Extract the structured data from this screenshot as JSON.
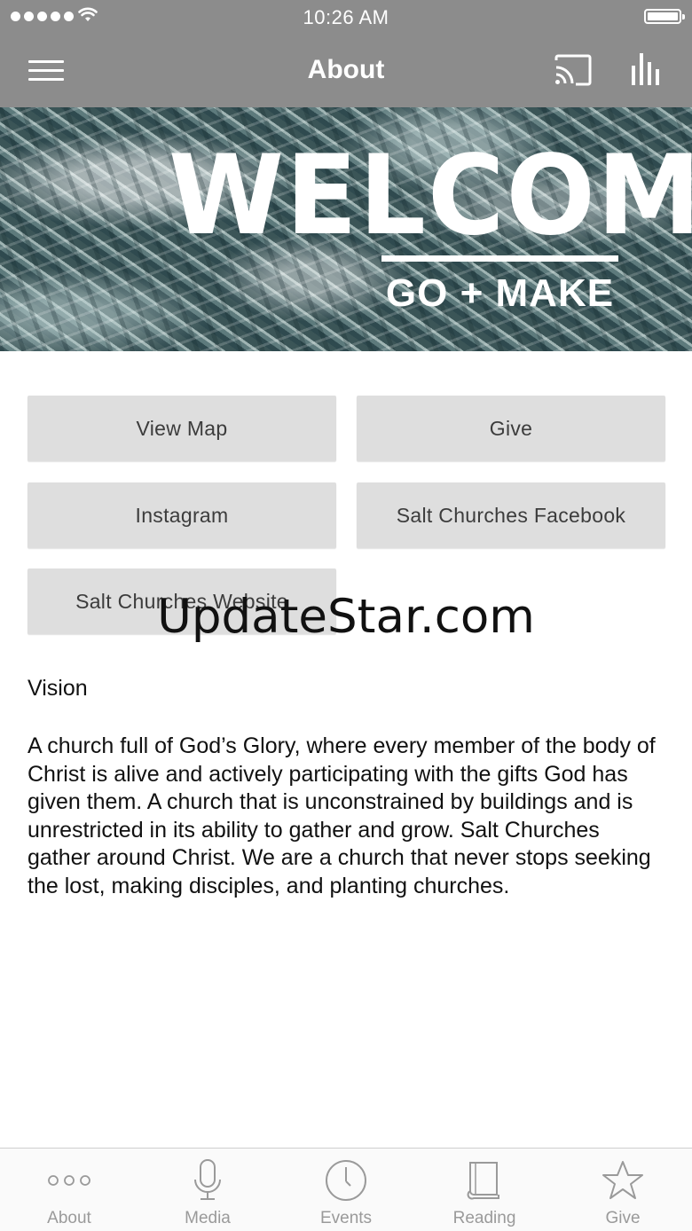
{
  "status_bar": {
    "time": "10:26 AM"
  },
  "nav": {
    "title": "About"
  },
  "banner": {
    "headline": "WELCOME",
    "tagline": "GO + MAKE"
  },
  "buttons": {
    "view_map": "View Map",
    "give": "Give",
    "instagram": "Instagram",
    "facebook": "Salt Churches Facebook",
    "website": "Salt Churches Website"
  },
  "watermark": "UpdateStar.com",
  "vision": {
    "title": "Vision",
    "body": "A church full of God’s Glory, where every member of the body of Christ is alive and actively participating with the gifts God has given them. A church that is unconstrained by buildings and is unrestricted in its ability to gather and grow. Salt Churches gather around Christ. We are a church that never stops seeking the lost, making disciples, and planting churches."
  },
  "tabs": [
    {
      "label": "About",
      "icon": "more-dots-icon"
    },
    {
      "label": "Media",
      "icon": "microphone-icon"
    },
    {
      "label": "Events",
      "icon": "clock-icon"
    },
    {
      "label": "Reading",
      "icon": "book-icon"
    },
    {
      "label": "Give",
      "icon": "star-icon"
    }
  ],
  "colors": {
    "header": "#8c8c8c",
    "button_bg": "#dedede",
    "tab_inactive": "#9a9a9a"
  }
}
